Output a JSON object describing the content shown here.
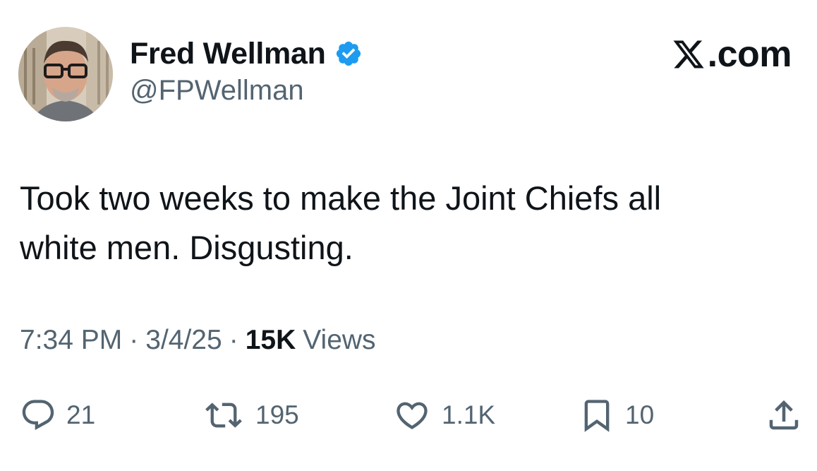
{
  "author": {
    "display_name": "Fred Wellman",
    "handle": "@FPWellman",
    "verified": true,
    "avatar_icon": "profile-photo"
  },
  "site_label": ".com",
  "tweet": {
    "text_line1": "Took two weeks to make the Joint Chiefs all",
    "text_line2": "white men. Disgusting."
  },
  "meta": {
    "time": "7:34 PM",
    "separator": "·",
    "date": "3/4/25",
    "views_count": "15K",
    "views_label": "Views"
  },
  "actions": {
    "replies": "21",
    "reposts": "195",
    "likes": "1.1K",
    "bookmarks": "10"
  },
  "colors": {
    "text": "#0f1419",
    "secondary": "#536471",
    "verified_blue": "#1d9bf0"
  }
}
